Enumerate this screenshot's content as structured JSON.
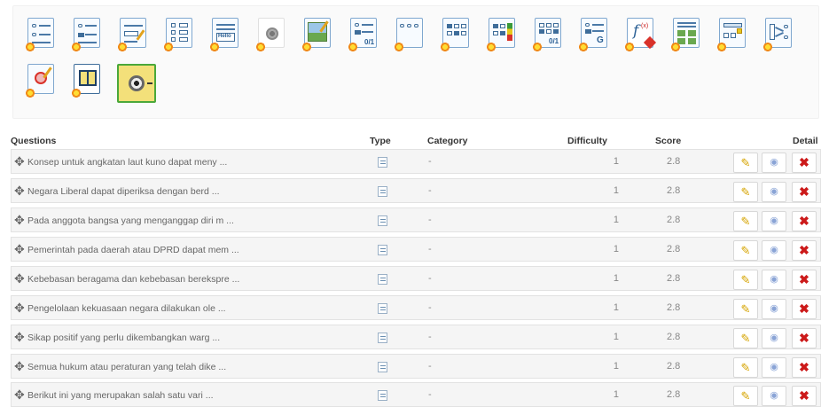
{
  "toolbar": {
    "tools": [
      {
        "icon": "unique-answer-icon"
      },
      {
        "icon": "multiple-answer-icon"
      },
      {
        "icon": "fill-blanks-icon"
      },
      {
        "icon": "matching-icon"
      },
      {
        "icon": "open-question-icon",
        "tag": "Hello"
      },
      {
        "icon": "oral-expression-icon"
      },
      {
        "icon": "image-zones-icon"
      },
      {
        "icon": "exact-answer-icon",
        "tag": "0/1"
      },
      {
        "icon": "unique-answer-no-option-icon"
      },
      {
        "icon": "multiple-answer-true-false-icon"
      },
      {
        "icon": "degree-certainty-icon"
      },
      {
        "icon": "combination-true-false-icon",
        "tag": "0/1"
      },
      {
        "icon": "global-multiple-answer-icon",
        "tag": "G"
      },
      {
        "icon": "calculated-answer-icon"
      },
      {
        "icon": "unique-answer-image-icon"
      },
      {
        "icon": "drag-and-drop-icon"
      },
      {
        "icon": "match-arrows-icon"
      },
      {
        "icon": "annotation-icon"
      },
      {
        "icon": "reading-comprehension-icon"
      },
      {
        "icon": "media-question-icon"
      }
    ]
  },
  "table": {
    "headers": {
      "questions": "Questions",
      "type": "Type",
      "category": "Category",
      "difficulty": "Difficulty",
      "score": "Score",
      "detail": "Detail"
    },
    "rows": [
      {
        "question": "Konsep untuk angkatan laut kuno dapat meny ...",
        "category": "-",
        "difficulty": "1",
        "score": "2.8"
      },
      {
        "question": "Negara Liberal dapat diperiksa dengan berd ...",
        "category": "-",
        "difficulty": "1",
        "score": "2.8"
      },
      {
        "question": "Pada anggota bangsa yang menganggap diri m ...",
        "category": "-",
        "difficulty": "1",
        "score": "2.8"
      },
      {
        "question": "Pemerintah pada daerah atau DPRD dapat mem ...",
        "category": "-",
        "difficulty": "1",
        "score": "2.8"
      },
      {
        "question": "Kebebasan beragama dan kebebasan berekspre ...",
        "category": "-",
        "difficulty": "1",
        "score": "2.8"
      },
      {
        "question": "Pengelolaan kekuasaan negara dilakukan ole ...",
        "category": "-",
        "difficulty": "1",
        "score": "2.8"
      },
      {
        "question": "Sikap positif yang perlu dikembangkan warg ...",
        "category": "-",
        "difficulty": "1",
        "score": "2.8"
      },
      {
        "question": "Semua hukum atau peraturan yang telah dike ...",
        "category": "-",
        "difficulty": "1",
        "score": "2.8"
      },
      {
        "question": "Berikut ini yang merupakan salah satu vari ...",
        "category": "-",
        "difficulty": "1",
        "score": "2.8"
      }
    ]
  },
  "icons": {
    "move": "✥",
    "edit": "✎",
    "preview": "◉",
    "delete": "✖"
  },
  "colors": {
    "icon_border": "#7fa7cf",
    "selected_border": "#4aa83a",
    "delete": "#cc1a1a",
    "edit": "#d6a400"
  }
}
